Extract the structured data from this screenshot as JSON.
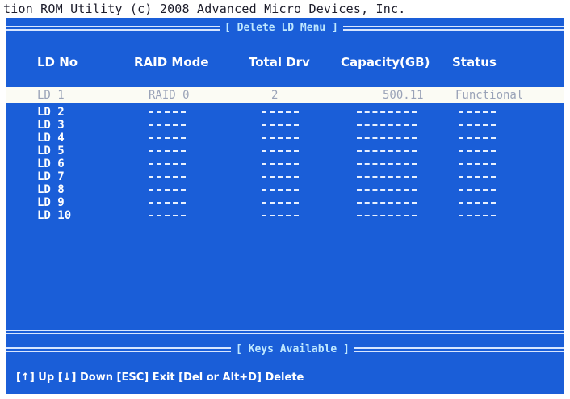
{
  "top_text": "tion ROM Utility (c) 2008 Advanced Micro Devices, Inc.",
  "menu_title": "[ Delete LD Menu ]",
  "headers": {
    "ld_no": "LD No",
    "raid_mode": "RAID Mode",
    "total_drv": "Total Drv",
    "capacity": "Capacity(GB)",
    "status": "Status"
  },
  "rows": [
    {
      "ld": "LD  1",
      "raid_mode": "RAID 0",
      "total_drv": "2",
      "capacity": "500.11",
      "status": "Functional"
    },
    {
      "ld": "LD  2",
      "raid_mode": "----",
      "total_drv": "----",
      "capacity": "--------",
      "status": "----"
    },
    {
      "ld": "LD  3",
      "raid_mode": "----",
      "total_drv": "----",
      "capacity": "--------",
      "status": "----"
    },
    {
      "ld": "LD  4",
      "raid_mode": "----",
      "total_drv": "----",
      "capacity": "--------",
      "status": "----"
    },
    {
      "ld": "LD  5",
      "raid_mode": "----",
      "total_drv": "----",
      "capacity": "--------",
      "status": "----"
    },
    {
      "ld": "LD  6",
      "raid_mode": "----",
      "total_drv": "----",
      "capacity": "--------",
      "status": "----"
    },
    {
      "ld": "LD  7",
      "raid_mode": "----",
      "total_drv": "----",
      "capacity": "--------",
      "status": "----"
    },
    {
      "ld": "LD  8",
      "raid_mode": "----",
      "total_drv": "----",
      "capacity": "--------",
      "status": "----"
    },
    {
      "ld": "LD  9",
      "raid_mode": "----",
      "total_drv": "----",
      "capacity": "--------",
      "status": "----"
    },
    {
      "ld": "LD 10",
      "raid_mode": "----",
      "total_drv": "----",
      "capacity": "--------",
      "status": "----"
    }
  ],
  "keys_title": "[ Keys Available ]",
  "keys_text": "[↑] Up [↓] Down [ESC] Exit [Del or Alt+D] Delete",
  "colors": {
    "background": "#1a5ed8",
    "highlight": "#fbfbf4",
    "title_text": "#bfe8ff"
  }
}
